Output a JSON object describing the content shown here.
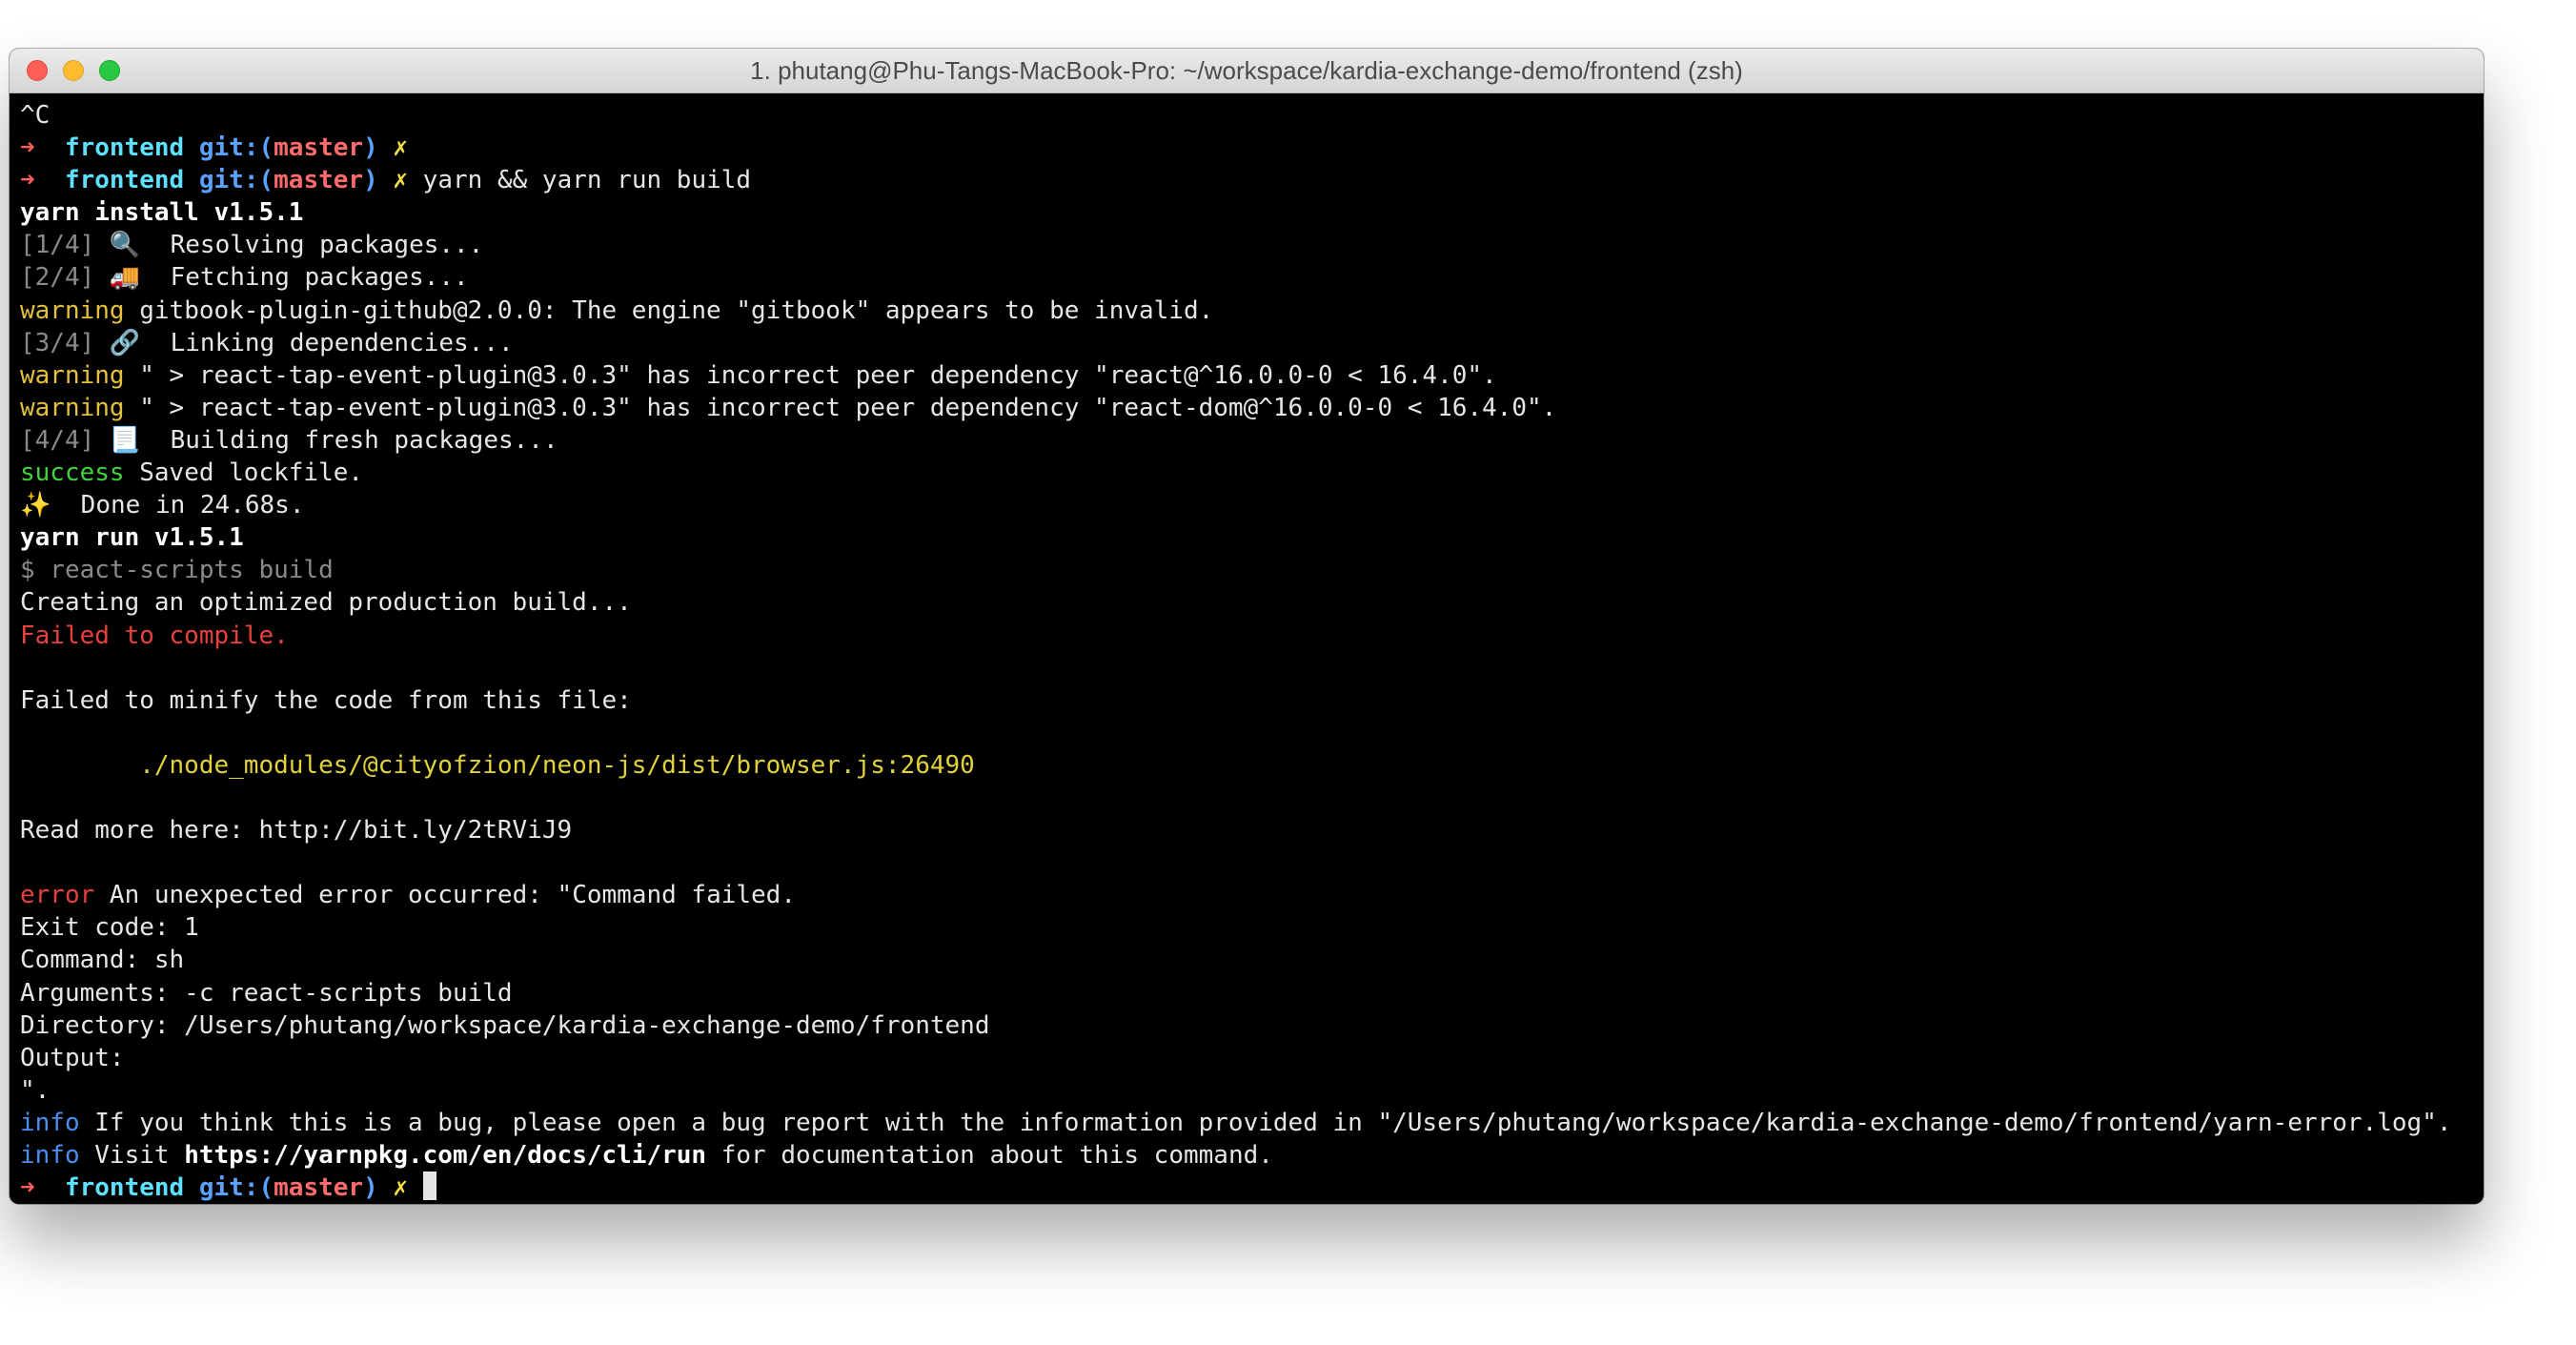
{
  "window": {
    "title": "1. phutang@Phu-Tangs-MacBook-Pro: ~/workspace/kardia-exchange-demo/frontend (zsh)",
    "traffic_lights": [
      "close-button",
      "minimize-button",
      "zoom-button"
    ]
  },
  "colors": {
    "close": "#fe5f57",
    "minimize": "#febc2e",
    "zoom": "#28c840",
    "terminal_bg": "#000000",
    "prompt_arrow": "#ff5f57",
    "prompt_dir": "#5ee1ff",
    "prompt_git": "#5aa2ff",
    "prompt_branch": "#ff6b6b",
    "prompt_dirty": "#f5e146",
    "warning": "#e5c13b",
    "success": "#3fd43f",
    "error": "#e8403c",
    "info": "#4a8ef0"
  },
  "terminal": {
    "lines": [
      [
        {
          "t": "^C",
          "c": "default"
        }
      ],
      [
        {
          "t": "➜ ",
          "c": "arrow"
        },
        {
          "t": " frontend ",
          "c": "dir"
        },
        {
          "t": "git:(",
          "c": "git"
        },
        {
          "t": "master",
          "c": "branch"
        },
        {
          "t": ")",
          "c": "git"
        },
        {
          "t": " ✗",
          "c": "dirty"
        }
      ],
      [
        {
          "t": "➜ ",
          "c": "arrow"
        },
        {
          "t": " frontend ",
          "c": "dir"
        },
        {
          "t": "git:(",
          "c": "git"
        },
        {
          "t": "master",
          "c": "branch"
        },
        {
          "t": ")",
          "c": "git"
        },
        {
          "t": " ✗",
          "c": "dirty"
        },
        {
          "t": " yarn && yarn run build",
          "c": "default"
        }
      ],
      [
        {
          "t": "yarn install v1.5.1",
          "c": "bold"
        }
      ],
      [
        {
          "t": "[1/4]",
          "c": "dim"
        },
        {
          "t": " 🔍  Resolving packages...",
          "c": "default"
        }
      ],
      [
        {
          "t": "[2/4]",
          "c": "dim"
        },
        {
          "t": " 🚚  Fetching packages...",
          "c": "default"
        }
      ],
      [
        {
          "t": "warning",
          "c": "warn"
        },
        {
          "t": " gitbook-plugin-github@2.0.0: The engine \"gitbook\" appears to be invalid.",
          "c": "default"
        }
      ],
      [
        {
          "t": "[3/4]",
          "c": "dim"
        },
        {
          "t": " 🔗  Linking dependencies...",
          "c": "default"
        }
      ],
      [
        {
          "t": "warning",
          "c": "warn"
        },
        {
          "t": " \" > react-tap-event-plugin@3.0.3\" has incorrect peer dependency \"react@^16.0.0-0 < 16.4.0\".",
          "c": "default"
        }
      ],
      [
        {
          "t": "warning",
          "c": "warn"
        },
        {
          "t": " \" > react-tap-event-plugin@3.0.3\" has incorrect peer dependency \"react-dom@^16.0.0-0 < 16.4.0\".",
          "c": "default"
        }
      ],
      [
        {
          "t": "[4/4]",
          "c": "dim"
        },
        {
          "t": " 📃  Building fresh packages...",
          "c": "default"
        }
      ],
      [
        {
          "t": "success",
          "c": "success"
        },
        {
          "t": " Saved lockfile.",
          "c": "default"
        }
      ],
      [
        {
          "t": "✨  Done in 24.68s.",
          "c": "default"
        }
      ],
      [
        {
          "t": "yarn run v1.5.1",
          "c": "bold"
        }
      ],
      [
        {
          "t": "$ react-scripts build",
          "c": "dim"
        }
      ],
      [
        {
          "t": "Creating an optimized production build...",
          "c": "default"
        }
      ],
      [
        {
          "t": "Failed to compile.",
          "c": "error"
        }
      ],
      [
        {
          "t": "",
          "c": "default"
        }
      ],
      [
        {
          "t": "Failed to minify the code from this file:",
          "c": "default"
        }
      ],
      [
        {
          "t": "",
          "c": "default"
        }
      ],
      [
        {
          "t": "        ./node_modules/@cityofzion/neon-js/dist/browser.js:26490",
          "c": "path"
        }
      ],
      [
        {
          "t": "",
          "c": "default"
        }
      ],
      [
        {
          "t": "Read more here: http://bit.ly/2tRViJ9",
          "c": "default"
        }
      ],
      [
        {
          "t": "",
          "c": "default"
        }
      ],
      [
        {
          "t": "error",
          "c": "error"
        },
        {
          "t": " An unexpected error occurred: \"Command failed.",
          "c": "default"
        }
      ],
      [
        {
          "t": "Exit code: 1",
          "c": "default"
        }
      ],
      [
        {
          "t": "Command: sh",
          "c": "default"
        }
      ],
      [
        {
          "t": "Arguments: -c react-scripts build",
          "c": "default"
        }
      ],
      [
        {
          "t": "Directory: /Users/phutang/workspace/kardia-exchange-demo/frontend",
          "c": "default"
        }
      ],
      [
        {
          "t": "Output:",
          "c": "default"
        }
      ],
      [
        {
          "t": "\".",
          "c": "default"
        }
      ],
      [
        {
          "t": "info",
          "c": "info"
        },
        {
          "t": " If you think this is a bug, please open a bug report with the information provided in \"/Users/phutang/workspace/kardia-exchange-demo/frontend/yarn-error.log\".",
          "c": "default"
        }
      ],
      [
        {
          "t": "info",
          "c": "info"
        },
        {
          "t": " Visit ",
          "c": "default"
        },
        {
          "t": "https://yarnpkg.com/en/docs/cli/run",
          "c": "url"
        },
        {
          "t": " for documentation about this command.",
          "c": "default"
        }
      ],
      [
        {
          "t": "➜ ",
          "c": "arrow"
        },
        {
          "t": " frontend ",
          "c": "dir"
        },
        {
          "t": "git:(",
          "c": "git"
        },
        {
          "t": "master",
          "c": "branch"
        },
        {
          "t": ")",
          "c": "git"
        },
        {
          "t": " ✗",
          "c": "dirty"
        },
        {
          "t": " ",
          "c": "default"
        }
      ]
    ]
  }
}
